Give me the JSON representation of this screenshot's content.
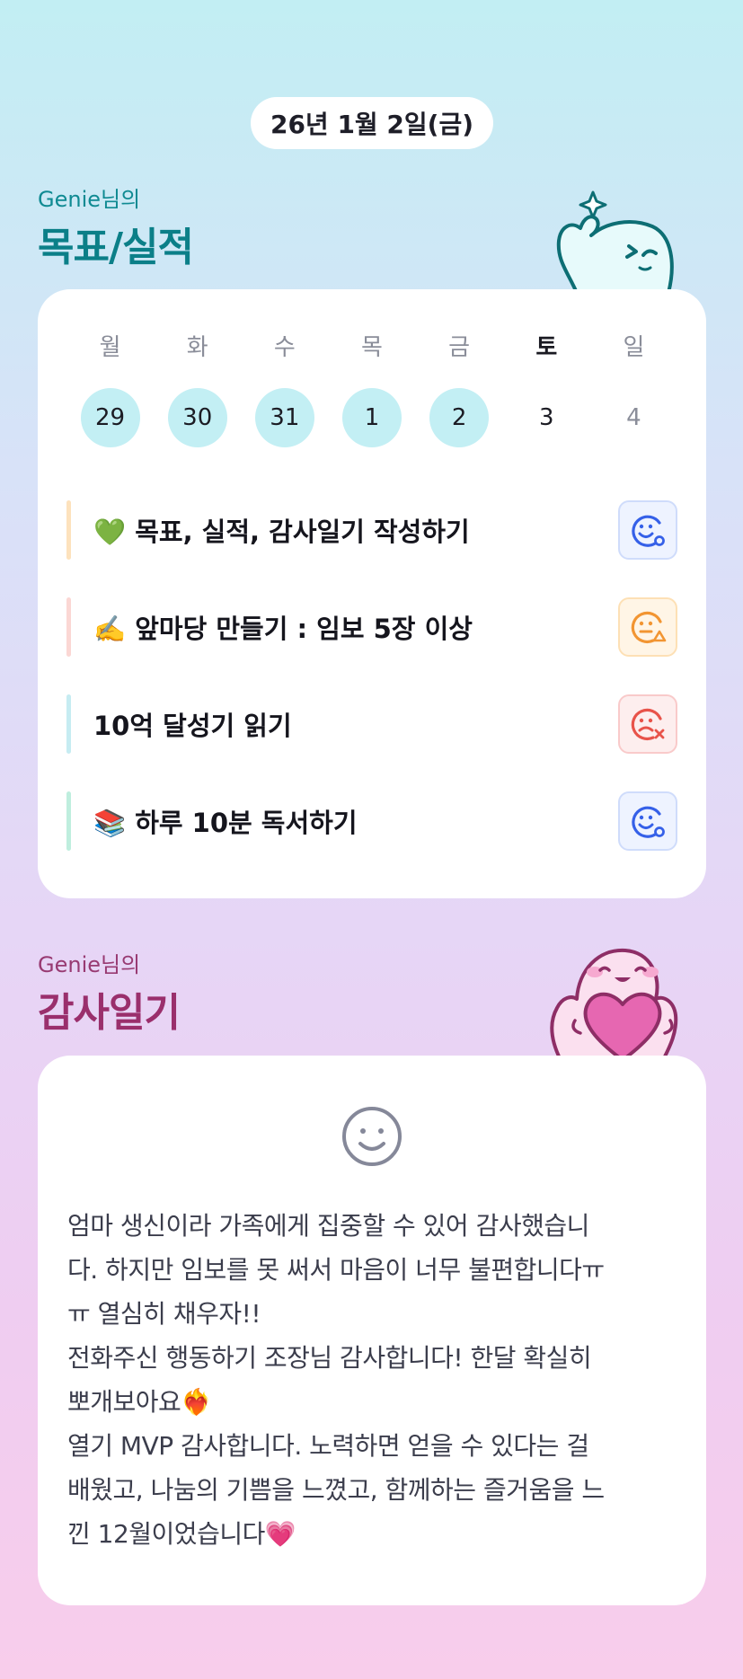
{
  "date_label": "26년 1월 2일(금)",
  "goals_section": {
    "owner": "Genie님의",
    "title": "목표/실적"
  },
  "week": {
    "days": [
      {
        "dow": "월",
        "date": "29"
      },
      {
        "dow": "화",
        "date": "30"
      },
      {
        "dow": "수",
        "date": "31"
      },
      {
        "dow": "목",
        "date": "1"
      },
      {
        "dow": "금",
        "date": "2"
      },
      {
        "dow": "토",
        "date": "3"
      },
      {
        "dow": "일",
        "date": "4"
      }
    ]
  },
  "goals": [
    {
      "text": "💚 목표, 실적, 감사일기 작성하기",
      "status_icon": "smile-done-icon",
      "bar_color": "#fde2bd",
      "status_color": "#3560e8"
    },
    {
      "text": "✍️ 앞마당 만들기 : 임보 5장 이상",
      "status_icon": "neutral-warning-icon",
      "bar_color": "#fbd7d4",
      "status_color": "#f29532"
    },
    {
      "text": "10억 달성기 읽기",
      "status_icon": "sad-fail-icon",
      "bar_color": "#c6ecf2",
      "status_color": "#e8534a"
    },
    {
      "text": "📚 하루 10분 독서하기",
      "status_icon": "smile-done-icon",
      "bar_color": "#bfeede",
      "status_color": "#3560e8"
    }
  ],
  "thanks_section": {
    "owner": "Genie님의",
    "title": "감사일기",
    "mood_icon": "smile-face-icon",
    "lines": [
      "엄마 생신이라 가족에게 집중할 수 있어 감사했습니",
      "다. 하지만 임보를 못 써서 마음이 너무 불편합니다ㅠ",
      "ㅠ 열심히 채우자!!",
      "전화주신 행동하기 조장님 감사합니다! 한달 확실히",
      "뽀개보아요❤️‍🔥",
      "열기 MVP 감사합니다. 노력하면 얻을 수 있다는 걸",
      "배웠고, 나눔의 기쁨을 느꼈고, 함께하는 즐거움을 느",
      "낀 12월이었습니다💗"
    ]
  },
  "colors": {
    "accent_teal": "#0b7f88",
    "accent_plum": "#9a2f6c",
    "done_circle": "#c3eff4"
  }
}
